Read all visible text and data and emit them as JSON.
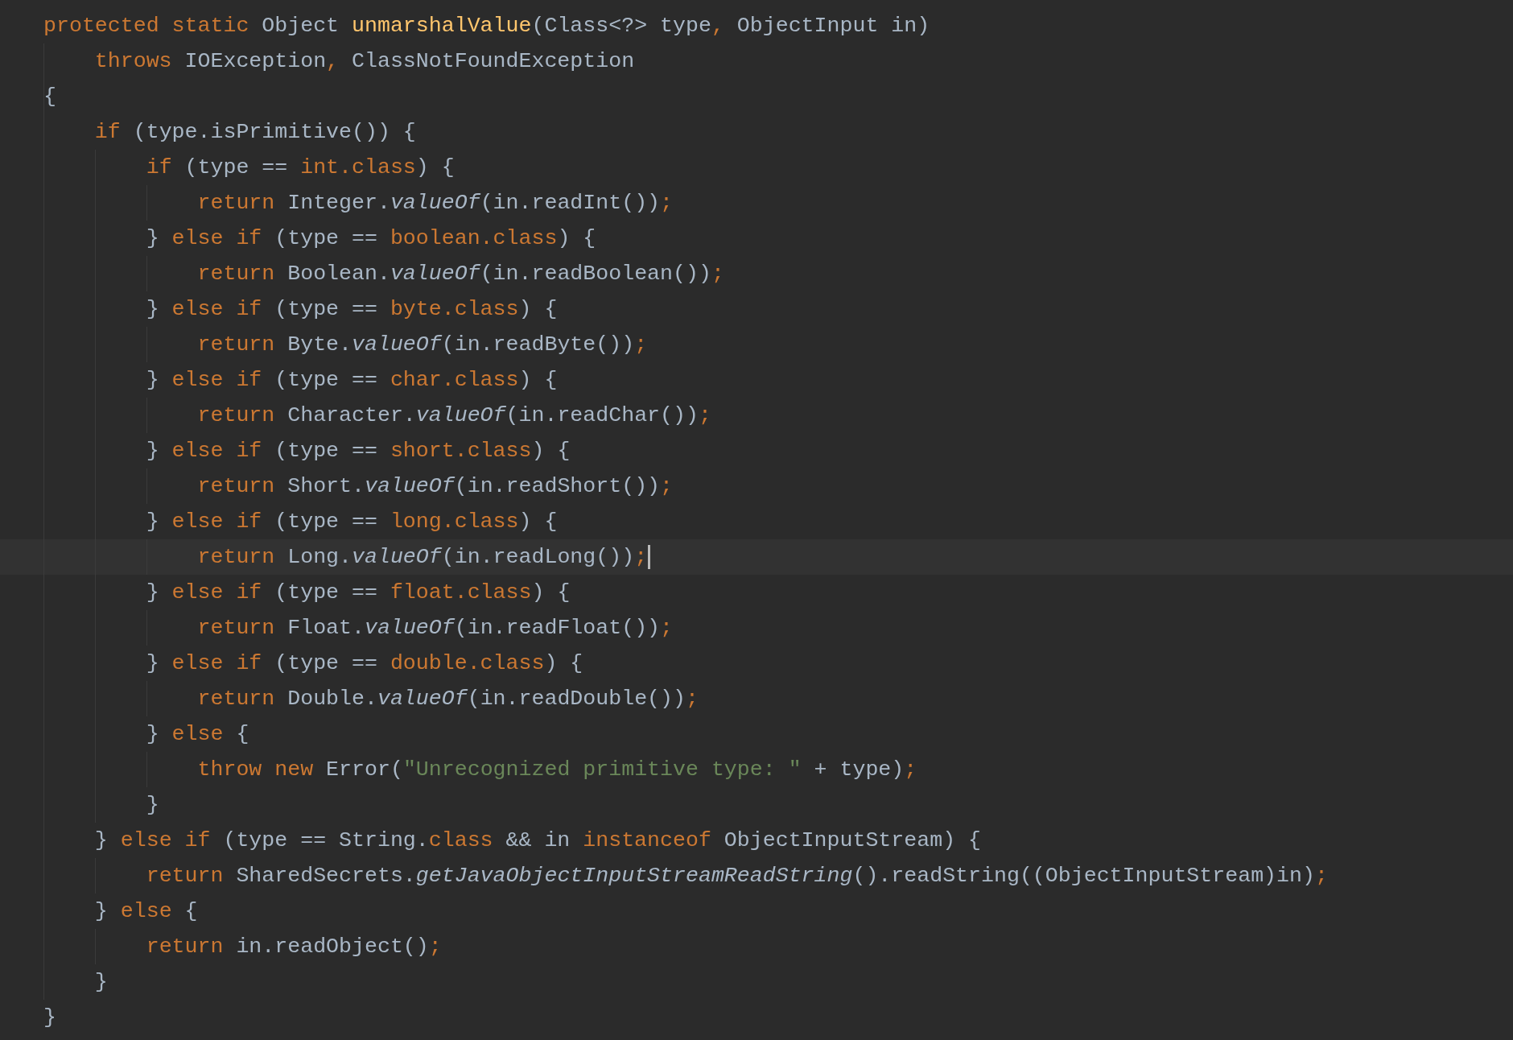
{
  "editor": {
    "lines": [
      {
        "current": false,
        "tokens": [
          {
            "kind": "keyword",
            "text": "protected static "
          },
          {
            "kind": "plain",
            "text": "Object "
          },
          {
            "kind": "declaration",
            "text": "unmarshalValue"
          },
          {
            "kind": "plain",
            "text": "(Class<?> type"
          },
          {
            "kind": "keyword",
            "text": ", "
          },
          {
            "kind": "plain",
            "text": "ObjectInput in)"
          }
        ]
      },
      {
        "current": false,
        "tokens": [
          {
            "kind": "keyword",
            "text": "    throws "
          },
          {
            "kind": "plain",
            "text": "IOException"
          },
          {
            "kind": "keyword",
            "text": ", "
          },
          {
            "kind": "plain",
            "text": "ClassNotFoundException"
          }
        ]
      },
      {
        "current": false,
        "tokens": [
          {
            "kind": "plain",
            "text": "{"
          }
        ]
      },
      {
        "current": false,
        "tokens": [
          {
            "kind": "keyword",
            "text": "    if "
          },
          {
            "kind": "plain",
            "text": "(type.isPrimitive()) {"
          }
        ]
      },
      {
        "current": false,
        "tokens": [
          {
            "kind": "keyword",
            "text": "        if "
          },
          {
            "kind": "plain",
            "text": "(type == "
          },
          {
            "kind": "keyword",
            "text": "int.class"
          },
          {
            "kind": "plain",
            "text": ") {"
          }
        ]
      },
      {
        "current": false,
        "tokens": [
          {
            "kind": "keyword",
            "text": "            return "
          },
          {
            "kind": "plain",
            "text": "Integer."
          },
          {
            "kind": "static",
            "text": "valueOf"
          },
          {
            "kind": "plain",
            "text": "(in.readInt())"
          },
          {
            "kind": "keyword",
            "text": ";"
          }
        ]
      },
      {
        "current": false,
        "tokens": [
          {
            "kind": "plain",
            "text": "        } "
          },
          {
            "kind": "keyword",
            "text": "else if "
          },
          {
            "kind": "plain",
            "text": "(type == "
          },
          {
            "kind": "keyword",
            "text": "boolean.class"
          },
          {
            "kind": "plain",
            "text": ") {"
          }
        ]
      },
      {
        "current": false,
        "tokens": [
          {
            "kind": "keyword",
            "text": "            return "
          },
          {
            "kind": "plain",
            "text": "Boolean."
          },
          {
            "kind": "static",
            "text": "valueOf"
          },
          {
            "kind": "plain",
            "text": "(in.readBoolean())"
          },
          {
            "kind": "keyword",
            "text": ";"
          }
        ]
      },
      {
        "current": false,
        "tokens": [
          {
            "kind": "plain",
            "text": "        } "
          },
          {
            "kind": "keyword",
            "text": "else if "
          },
          {
            "kind": "plain",
            "text": "(type == "
          },
          {
            "kind": "keyword",
            "text": "byte.class"
          },
          {
            "kind": "plain",
            "text": ") {"
          }
        ]
      },
      {
        "current": false,
        "tokens": [
          {
            "kind": "keyword",
            "text": "            return "
          },
          {
            "kind": "plain",
            "text": "Byte."
          },
          {
            "kind": "static",
            "text": "valueOf"
          },
          {
            "kind": "plain",
            "text": "(in.readByte())"
          },
          {
            "kind": "keyword",
            "text": ";"
          }
        ]
      },
      {
        "current": false,
        "tokens": [
          {
            "kind": "plain",
            "text": "        } "
          },
          {
            "kind": "keyword",
            "text": "else if "
          },
          {
            "kind": "plain",
            "text": "(type == "
          },
          {
            "kind": "keyword",
            "text": "char.class"
          },
          {
            "kind": "plain",
            "text": ") {"
          }
        ]
      },
      {
        "current": false,
        "tokens": [
          {
            "kind": "keyword",
            "text": "            return "
          },
          {
            "kind": "plain",
            "text": "Character."
          },
          {
            "kind": "static",
            "text": "valueOf"
          },
          {
            "kind": "plain",
            "text": "(in.readChar())"
          },
          {
            "kind": "keyword",
            "text": ";"
          }
        ]
      },
      {
        "current": false,
        "tokens": [
          {
            "kind": "plain",
            "text": "        } "
          },
          {
            "kind": "keyword",
            "text": "else if "
          },
          {
            "kind": "plain",
            "text": "(type == "
          },
          {
            "kind": "keyword",
            "text": "short.class"
          },
          {
            "kind": "plain",
            "text": ") {"
          }
        ]
      },
      {
        "current": false,
        "tokens": [
          {
            "kind": "keyword",
            "text": "            return "
          },
          {
            "kind": "plain",
            "text": "Short."
          },
          {
            "kind": "static",
            "text": "valueOf"
          },
          {
            "kind": "plain",
            "text": "(in.readShort())"
          },
          {
            "kind": "keyword",
            "text": ";"
          }
        ]
      },
      {
        "current": false,
        "tokens": [
          {
            "kind": "plain",
            "text": "        } "
          },
          {
            "kind": "keyword",
            "text": "else if "
          },
          {
            "kind": "plain",
            "text": "(type == "
          },
          {
            "kind": "keyword",
            "text": "long.class"
          },
          {
            "kind": "plain",
            "text": ") {"
          }
        ]
      },
      {
        "current": true,
        "tokens": [
          {
            "kind": "keyword",
            "text": "            return "
          },
          {
            "kind": "plain",
            "text": "Long."
          },
          {
            "kind": "static",
            "text": "valueOf"
          },
          {
            "kind": "plain",
            "text": "(in.readLong())"
          },
          {
            "kind": "keyword",
            "text": ";"
          }
        ]
      },
      {
        "current": false,
        "tokens": [
          {
            "kind": "plain",
            "text": "        } "
          },
          {
            "kind": "keyword",
            "text": "else if "
          },
          {
            "kind": "plain",
            "text": "(type == "
          },
          {
            "kind": "keyword",
            "text": "float.class"
          },
          {
            "kind": "plain",
            "text": ") {"
          }
        ]
      },
      {
        "current": false,
        "tokens": [
          {
            "kind": "keyword",
            "text": "            return "
          },
          {
            "kind": "plain",
            "text": "Float."
          },
          {
            "kind": "static",
            "text": "valueOf"
          },
          {
            "kind": "plain",
            "text": "(in.readFloat())"
          },
          {
            "kind": "keyword",
            "text": ";"
          }
        ]
      },
      {
        "current": false,
        "tokens": [
          {
            "kind": "plain",
            "text": "        } "
          },
          {
            "kind": "keyword",
            "text": "else if "
          },
          {
            "kind": "plain",
            "text": "(type == "
          },
          {
            "kind": "keyword",
            "text": "double.class"
          },
          {
            "kind": "plain",
            "text": ") {"
          }
        ]
      },
      {
        "current": false,
        "tokens": [
          {
            "kind": "keyword",
            "text": "            return "
          },
          {
            "kind": "plain",
            "text": "Double."
          },
          {
            "kind": "static",
            "text": "valueOf"
          },
          {
            "kind": "plain",
            "text": "(in.readDouble())"
          },
          {
            "kind": "keyword",
            "text": ";"
          }
        ]
      },
      {
        "current": false,
        "tokens": [
          {
            "kind": "plain",
            "text": "        } "
          },
          {
            "kind": "keyword",
            "text": "else "
          },
          {
            "kind": "plain",
            "text": "{"
          }
        ]
      },
      {
        "current": false,
        "tokens": [
          {
            "kind": "keyword",
            "text": "            throw new "
          },
          {
            "kind": "plain",
            "text": "Error("
          },
          {
            "kind": "string",
            "text": "\"Unrecognized primitive type: \""
          },
          {
            "kind": "plain",
            "text": " + type)"
          },
          {
            "kind": "keyword",
            "text": ";"
          }
        ]
      },
      {
        "current": false,
        "tokens": [
          {
            "kind": "plain",
            "text": "        }"
          }
        ]
      },
      {
        "current": false,
        "tokens": [
          {
            "kind": "plain",
            "text": "    } "
          },
          {
            "kind": "keyword",
            "text": "else if "
          },
          {
            "kind": "plain",
            "text": "(type == String."
          },
          {
            "kind": "keyword",
            "text": "class"
          },
          {
            "kind": "plain",
            "text": " && in "
          },
          {
            "kind": "keyword",
            "text": "instanceof "
          },
          {
            "kind": "plain",
            "text": "ObjectInputStream) {"
          }
        ]
      },
      {
        "current": false,
        "tokens": [
          {
            "kind": "keyword",
            "text": "        return "
          },
          {
            "kind": "plain",
            "text": "SharedSecrets."
          },
          {
            "kind": "static",
            "text": "getJavaObjectInputStreamReadString"
          },
          {
            "kind": "plain",
            "text": "().readString((ObjectInputStream)in)"
          },
          {
            "kind": "keyword",
            "text": ";"
          }
        ]
      },
      {
        "current": false,
        "tokens": [
          {
            "kind": "plain",
            "text": "    } "
          },
          {
            "kind": "keyword",
            "text": "else "
          },
          {
            "kind": "plain",
            "text": "{"
          }
        ]
      },
      {
        "current": false,
        "tokens": [
          {
            "kind": "keyword",
            "text": "        return "
          },
          {
            "kind": "plain",
            "text": "in.readObject()"
          },
          {
            "kind": "keyword",
            "text": ";"
          }
        ]
      },
      {
        "current": false,
        "tokens": [
          {
            "kind": "plain",
            "text": "    }"
          }
        ]
      },
      {
        "current": false,
        "tokens": [
          {
            "kind": "plain",
            "text": "}"
          }
        ]
      }
    ]
  }
}
